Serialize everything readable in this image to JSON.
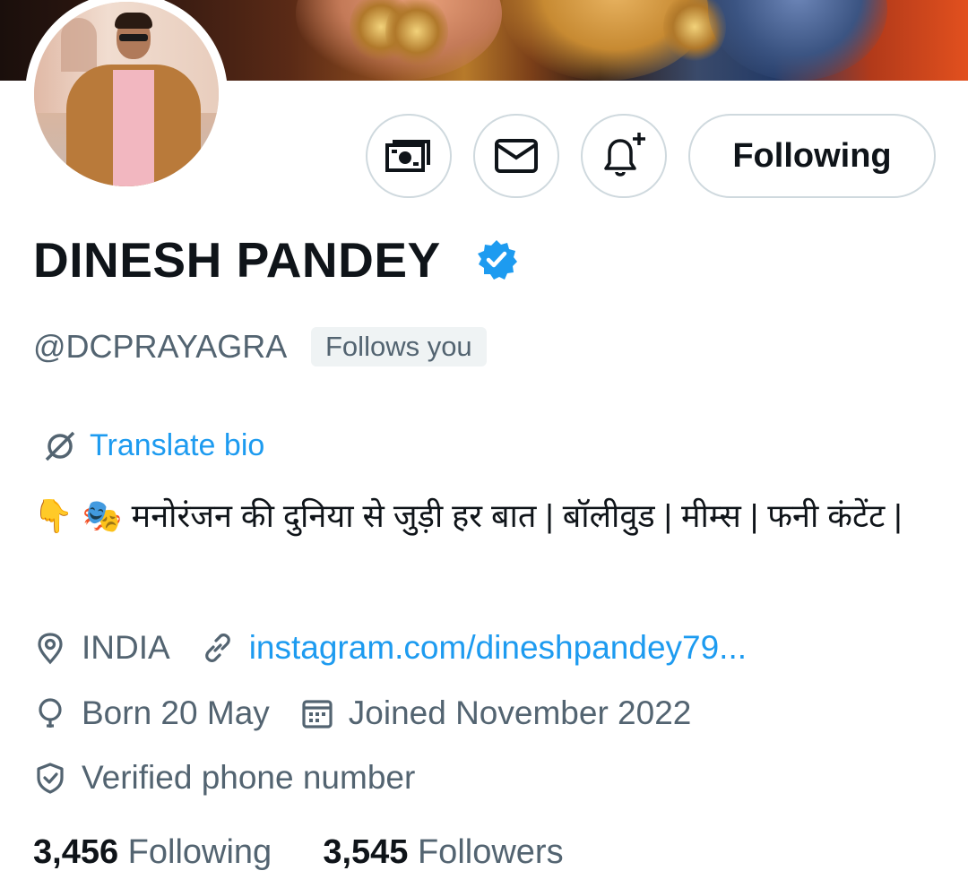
{
  "profile": {
    "name": "DINESH PANDEY",
    "handle": "@DCPRAYAGRA",
    "follows_you_badge": "Follows you",
    "translate_bio": "Translate bio",
    "bio_emojis": "👇 🎭",
    "bio_text": "मनोरंजन की दुनिया से जुड़ी हर बात | बॉलीवुड | मीम्स | फनी कंटेंट |",
    "location": "INDIA",
    "website": "instagram.com/dineshpandey79...",
    "birthday": "Born 20 May",
    "joined": "Joined November 2022",
    "verified_phone": "Verified phone number"
  },
  "actions": {
    "follow_label": "Following"
  },
  "stats": {
    "following_count": "3,456",
    "following_label": "Following",
    "followers_count": "3,545",
    "followers_label": "Followers"
  },
  "colors": {
    "accent": "#1d9bf0",
    "secondary_text": "#536471",
    "primary_text": "#0f1419",
    "border": "#cfd9de"
  },
  "icons": [
    "money-icon",
    "message-icon",
    "notification-plus-icon",
    "verified-badge-icon",
    "translate-icon",
    "location-icon",
    "link-icon",
    "birthday-icon",
    "calendar-icon",
    "verified-phone-icon"
  ]
}
